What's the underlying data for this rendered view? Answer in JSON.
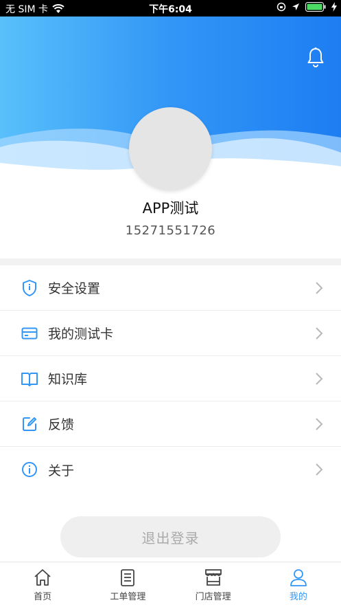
{
  "status_bar": {
    "carrier": "无 SIM 卡",
    "time": "下午6:04",
    "icons": [
      "wifi-icon",
      "orientation-lock-icon",
      "location-icon",
      "battery-icon",
      "charging-icon"
    ]
  },
  "header": {
    "bell_icon": "bell-icon",
    "gradient_colors": [
      "#59c0fb",
      "#1d7df2"
    ]
  },
  "profile": {
    "name": "APP测试",
    "phone": "15271551726"
  },
  "menu": {
    "items": [
      {
        "label": "安全设置",
        "icon": "shield-icon"
      },
      {
        "label": "我的测试卡",
        "icon": "card-icon"
      },
      {
        "label": "知识库",
        "icon": "book-icon"
      },
      {
        "label": "反馈",
        "icon": "edit-icon"
      },
      {
        "label": "关于",
        "icon": "info-icon"
      }
    ]
  },
  "logout_label": "退出登录",
  "tabbar": {
    "tabs": [
      {
        "label": "首页",
        "icon": "home-icon",
        "active": false
      },
      {
        "label": "工单管理",
        "icon": "clipboard-icon",
        "active": false
      },
      {
        "label": "门店管理",
        "icon": "store-icon",
        "active": false
      },
      {
        "label": "我的",
        "icon": "person-icon",
        "active": true
      }
    ],
    "active_color": "#3296f6"
  }
}
